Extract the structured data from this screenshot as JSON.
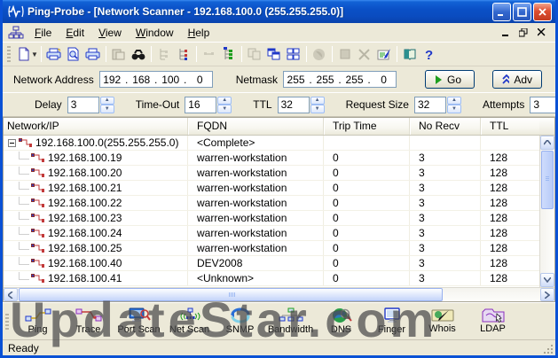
{
  "window": {
    "title": "Ping-Probe - [Network Scanner - 192.168.100.0 (255.255.255.0)]"
  },
  "menu": {
    "items": [
      "File",
      "Edit",
      "View",
      "Window",
      "Help"
    ]
  },
  "top_toolbar_icons": [
    "new-document-icon",
    "dropdown-caret-icon",
    "print-setup-icon",
    "print-preview-icon",
    "print-icon",
    "paste-icon",
    "find-binoculars-icon",
    "tree-list-disabled-icon",
    "tree-list-icon",
    "subtree-disabled-icon",
    "org-tree-icon",
    "copy-window-disabled-icon",
    "cascade-windows-icon",
    "tile-windows-icon",
    "globe-disabled-icon",
    "stop-disabled-icon",
    "delete-disabled-icon",
    "properties-icon",
    "book-icon",
    "help-icon"
  ],
  "address_bar": {
    "network_address_label": "Network Address",
    "network_address": [
      "192",
      "168",
      "100",
      "0"
    ],
    "netmask_label": "Netmask",
    "netmask": [
      "255",
      "255",
      "255",
      "0"
    ],
    "go_label": "Go",
    "adv_label": "Adv"
  },
  "params": [
    {
      "label": "Delay",
      "value": "3"
    },
    {
      "label": "Time-Out",
      "value": "16"
    },
    {
      "label": "TTL",
      "value": "32"
    },
    {
      "label": "Request Size",
      "value": "32"
    },
    {
      "label": "Attempts",
      "value": "3"
    }
  ],
  "table": {
    "columns": [
      "Network/IP",
      "FQDN",
      "Trip Time",
      "No Recv",
      "TTL"
    ],
    "rows": [
      {
        "ip": "192.168.100.0(255.255.255.0)",
        "fqdn": "<Complete>",
        "trip": "",
        "norecv": "",
        "ttl": "",
        "root": true
      },
      {
        "ip": "192.168.100.19",
        "fqdn": "warren-workstation",
        "trip": "0",
        "norecv": "3",
        "ttl": "128"
      },
      {
        "ip": "192.168.100.20",
        "fqdn": "warren-workstation",
        "trip": "0",
        "norecv": "3",
        "ttl": "128"
      },
      {
        "ip": "192.168.100.21",
        "fqdn": "warren-workstation",
        "trip": "0",
        "norecv": "3",
        "ttl": "128"
      },
      {
        "ip": "192.168.100.22",
        "fqdn": "warren-workstation",
        "trip": "0",
        "norecv": "3",
        "ttl": "128"
      },
      {
        "ip": "192.168.100.23",
        "fqdn": "warren-workstation",
        "trip": "0",
        "norecv": "3",
        "ttl": "128"
      },
      {
        "ip": "192.168.100.24",
        "fqdn": "warren-workstation",
        "trip": "0",
        "norecv": "3",
        "ttl": "128"
      },
      {
        "ip": "192.168.100.25",
        "fqdn": "warren-workstation",
        "trip": "0",
        "norecv": "3",
        "ttl": "128"
      },
      {
        "ip": "192.168.100.40",
        "fqdn": "DEV2008",
        "trip": "0",
        "norecv": "3",
        "ttl": "128"
      },
      {
        "ip": "192.168.100.41",
        "fqdn": "<Unknown>",
        "trip": "0",
        "norecv": "3",
        "ttl": "128"
      }
    ]
  },
  "bottom_toolbar": {
    "buttons": [
      {
        "label": "Ping",
        "icon": "ping-icon"
      },
      {
        "label": "Trace",
        "icon": "trace-icon"
      },
      {
        "label": "Port Scan",
        "icon": "port-scan-icon"
      },
      {
        "label": "Net Scan",
        "icon": "net-scan-icon"
      },
      {
        "label": "SNMP",
        "icon": "snmp-icon"
      },
      {
        "label": "Bandwidth",
        "icon": "bandwidth-icon"
      },
      {
        "label": "DNS",
        "icon": "dns-icon"
      },
      {
        "label": "Finger",
        "icon": "finger-icon"
      },
      {
        "label": "Whois",
        "icon": "whois-icon"
      },
      {
        "label": "LDAP",
        "icon": "ldap-icon"
      }
    ]
  },
  "status_bar": {
    "text": "Ready"
  },
  "watermark": "UpdateStar.com",
  "colors": {
    "titlebar_blue": "#0A50C6",
    "window_border": "#0A51D5",
    "close_red": "#DD4D31",
    "chrome_beige": "#ECE9D8",
    "go_green": "#1E9E1E",
    "adv_blue": "#2038C8",
    "watermark_gray": "#4B4B4B",
    "input_border": "#7F9DB9"
  }
}
